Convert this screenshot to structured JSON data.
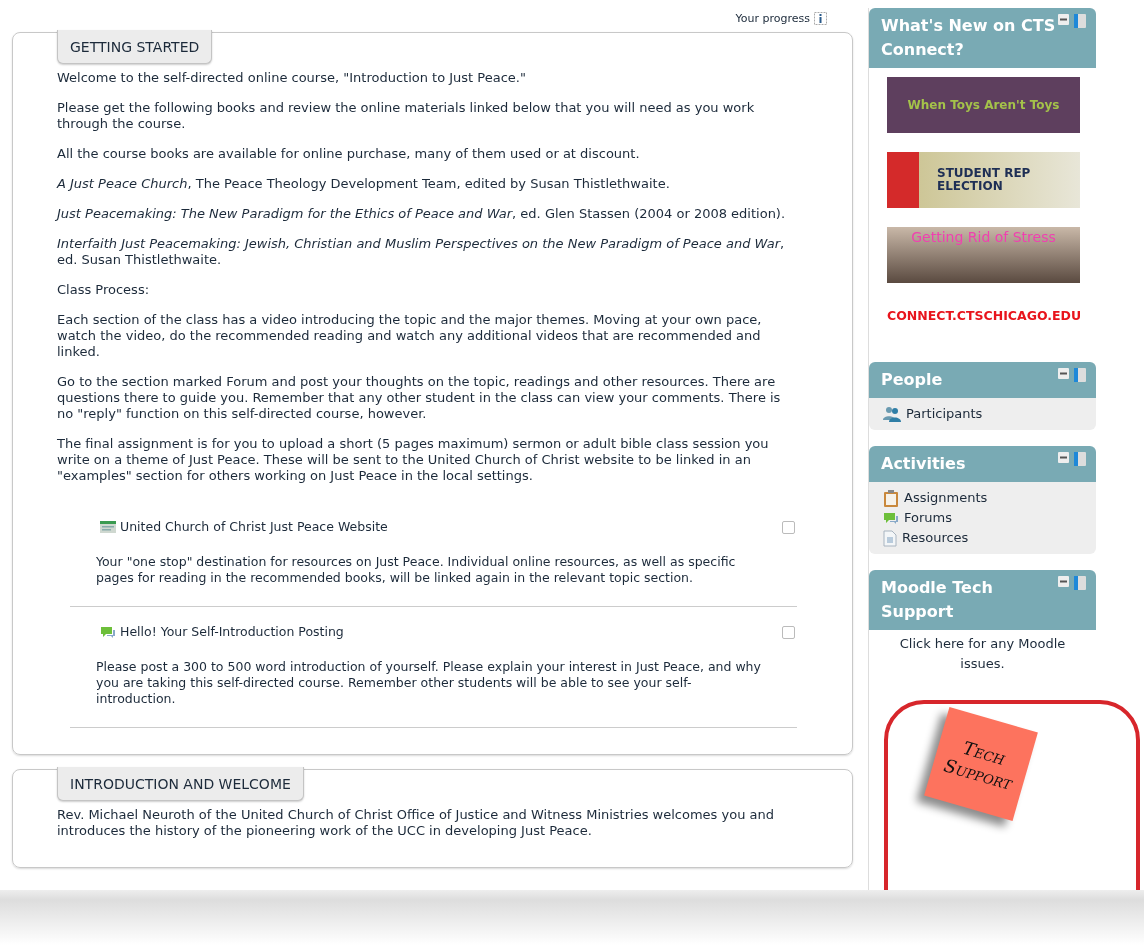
{
  "progress": {
    "label": "Your progress"
  },
  "sections": [
    {
      "title": "GETTING STARTED",
      "paragraphs": [
        "Welcome to the self-directed online course, \"Introduction to Just Peace.\"",
        "Please get the following books and review the online materials linked below that you will need as you work through the course.",
        "All the course books are available for online purchase, many of them used or at discount.",
        "*A Just Peace Church*, The Peace Theology Development Team, edited by Susan Thistlethwaite.",
        "*Just Peacemaking: The New Paradigm for the Ethics of Peace and War*, ed. Glen Stassen (2004 or 2008 edition).",
        "*Interfaith Just Peacemaking: Jewish, Christian and Muslim Perspectives on the New Paradigm of Peace and War*, ed. Susan Thistlethwaite.",
        "Class Process:",
        "Each section of the class has a video introducing the topic and the major themes. Moving at your own pace, watch the video, do the recommended reading and watch any additional videos that are recommended and linked.",
        "Go to the section marked Forum and post your thoughts on the topic, readings and other resources. There are questions there to guide you.  Remember that any other student in the class can view your comments.  There is no \"reply\" function on this self-directed course, however.",
        "The final assignment is for you to upload a short (5 pages maximum) sermon or adult bible class session you write on a theme of Just Peace.  These will be sent to the United Church of Christ website to be linked in an \"examples\" section for others working on Just Peace in the local settings."
      ],
      "activities": [
        {
          "kind": "url",
          "title": "United Church of Christ Just Peace Website",
          "checked": false,
          "description": "Your \"one stop\" destination for resources on Just Peace. Individual online resources, as well as specific pages for reading in the recommended books, will be linked again in the relevant topic section."
        },
        {
          "kind": "forum",
          "title": "Hello! Your Self-Introduction Posting",
          "checked": false,
          "description": "Please post a 300 to 500 word introduction of yourself.  Please explain your interest in Just Peace, and why you are taking this self-directed course. Remember other students will be able to see your self-introduction."
        }
      ]
    },
    {
      "title": "INTRODUCTION AND WELCOME",
      "paragraphs": [
        "Rev. Michael Neuroth of the United Church of Christ Office of Justice and Witness Ministries welcomes you and introduces the history of the pioneering work of the UCC in developing Just Peace."
      ]
    }
  ],
  "sidebar": [
    {
      "kind": "news",
      "title": "What's New on CTS Connect?",
      "banners": [
        {
          "kind": "blog",
          "caption": "When Toys Aren't Toys"
        },
        {
          "kind": "election",
          "caption": "STUDENT REP ELECTION"
        },
        {
          "kind": "photo",
          "caption": "Getting Rid of Stress"
        }
      ],
      "link": "CONNECT.CTSCHICAGO.EDU"
    },
    {
      "kind": "list",
      "title": "People",
      "items": [
        {
          "kind": "people",
          "label": "Participants"
        }
      ]
    },
    {
      "kind": "list",
      "title": "Activities",
      "items": [
        {
          "kind": "assignment",
          "label": "Assignments"
        },
        {
          "kind": "forum",
          "label": "Forums"
        },
        {
          "kind": "resource",
          "label": "Resources"
        }
      ]
    },
    {
      "kind": "support",
      "title": "Moodle Tech Support",
      "text": "Click here for any Moodle issues.",
      "note": "Tech Support"
    }
  ]
}
